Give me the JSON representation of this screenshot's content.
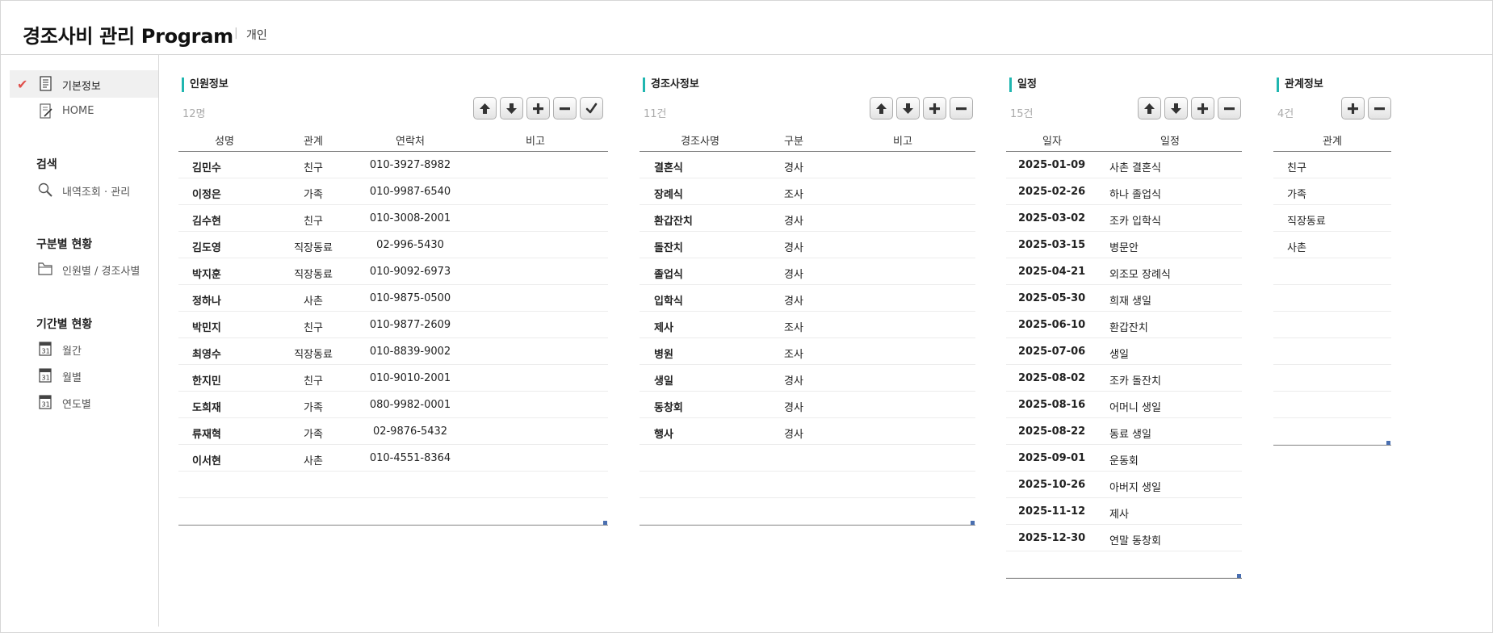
{
  "app": {
    "title": "경조사비 관리 Program",
    "separator": "|",
    "mode": "개인"
  },
  "sidebar": {
    "items": [
      {
        "label": "기본정보",
        "icon": "document-icon",
        "active": true
      },
      {
        "label": "HOME",
        "icon": "edit-document-icon"
      }
    ],
    "sections": [
      {
        "heading": "검색",
        "items": [
          {
            "label": "내역조회 · 관리",
            "icon": "magnifier-icon"
          }
        ]
      },
      {
        "heading": "구분별 현황",
        "items": [
          {
            "label": "인원별 / 경조사별",
            "icon": "folder-icon"
          }
        ]
      },
      {
        "heading": "기간별 현황",
        "items": [
          {
            "label": "월간",
            "icon": "calendar-icon"
          },
          {
            "label": "월별",
            "icon": "calendar-icon"
          },
          {
            "label": "연도별",
            "icon": "calendar-icon"
          }
        ]
      }
    ]
  },
  "accent_color": "#20b6b0",
  "check_color": "#e0504b",
  "panels": {
    "people": {
      "title": "인원정보",
      "count": "12명",
      "headers": [
        "성명",
        "관계",
        "연락처",
        "비고"
      ],
      "rows": [
        [
          "김민수",
          "친구",
          "010-3927-8982",
          ""
        ],
        [
          "이정은",
          "가족",
          "010-9987-6540",
          ""
        ],
        [
          "김수현",
          "친구",
          "010-3008-2001",
          ""
        ],
        [
          "김도영",
          "직장동료",
          "02-996-5430",
          ""
        ],
        [
          "박지훈",
          "직장동료",
          "010-9092-6973",
          ""
        ],
        [
          "정하나",
          "사촌",
          "010-9875-0500",
          ""
        ],
        [
          "박민지",
          "친구",
          "010-9877-2609",
          ""
        ],
        [
          "최영수",
          "직장동료",
          "010-8839-9002",
          ""
        ],
        [
          "한지민",
          "친구",
          "010-9010-2001",
          ""
        ],
        [
          "도희재",
          "가족",
          "080-9982-0001",
          ""
        ],
        [
          "류재혁",
          "가족",
          "02-9876-5432",
          ""
        ],
        [
          "이서현",
          "사촌",
          "010-4551-8364",
          ""
        ]
      ]
    },
    "events": {
      "title": "경조사정보",
      "count": "11건",
      "headers": [
        "경조사명",
        "구분",
        "비고"
      ],
      "rows": [
        [
          "결혼식",
          "경사",
          ""
        ],
        [
          "장례식",
          "조사",
          ""
        ],
        [
          "환갑잔치",
          "경사",
          ""
        ],
        [
          "돌잔치",
          "경사",
          ""
        ],
        [
          "졸업식",
          "경사",
          ""
        ],
        [
          "입학식",
          "경사",
          ""
        ],
        [
          "제사",
          "조사",
          ""
        ],
        [
          "병원",
          "조사",
          ""
        ],
        [
          "생일",
          "경사",
          ""
        ],
        [
          "동창회",
          "경사",
          ""
        ],
        [
          "행사",
          "경사",
          ""
        ]
      ]
    },
    "schedule": {
      "title": "일정",
      "count": "15건",
      "headers": [
        "일자",
        "일정"
      ],
      "rows": [
        [
          "2025-01-09",
          "사촌 결혼식"
        ],
        [
          "2025-02-26",
          "하나 졸업식"
        ],
        [
          "2025-03-02",
          "조카 입학식"
        ],
        [
          "2025-03-15",
          "병문안"
        ],
        [
          "2025-04-21",
          "외조모 장례식"
        ],
        [
          "2025-05-30",
          "희재 생일"
        ],
        [
          "2025-06-10",
          "환갑잔치"
        ],
        [
          "2025-07-06",
          "생일"
        ],
        [
          "2025-08-02",
          "조카 돌잔치"
        ],
        [
          "2025-08-16",
          "어머니 생일"
        ],
        [
          "2025-08-22",
          "동료 생일"
        ],
        [
          "2025-09-01",
          "운동회"
        ],
        [
          "2025-10-26",
          "아버지 생일"
        ],
        [
          "2025-11-12",
          "제사"
        ],
        [
          "2025-12-30",
          "연말 동창회"
        ]
      ]
    },
    "relations": {
      "title": "관계정보",
      "count": "4건",
      "headers": [
        "관계"
      ],
      "rows": [
        [
          "친구"
        ],
        [
          "가족"
        ],
        [
          "직장동료"
        ],
        [
          "사촌"
        ]
      ]
    }
  },
  "toolbar_buttons": {
    "up": "arrow-up-icon",
    "down": "arrow-down-icon",
    "add": "plus-icon",
    "remove": "minus-icon",
    "confirm": "check-icon"
  }
}
